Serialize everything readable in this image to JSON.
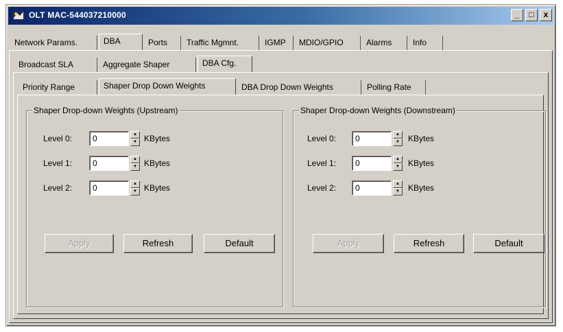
{
  "window": {
    "title": "OLT MAC-544037210000"
  },
  "caption_buttons": {
    "minimize": "_",
    "maximize": "□",
    "close": "x"
  },
  "tabs_main": [
    "Network Params.",
    "DBA",
    "Ports",
    "Traffic Mgmnt.",
    "IGMP",
    "MDIO/GPIO",
    "Alarms",
    "Info"
  ],
  "tabs_main_active": "DBA",
  "tabs_dba": [
    "Broadcast SLA",
    "Aggregate Shaper",
    "DBA Cfg."
  ],
  "tabs_dba_active": "DBA Cfg.",
  "tabs_cfg": [
    "Priority Range",
    "Shaper Drop Down Weights",
    "DBA Drop Down Weights",
    "Polling Rate"
  ],
  "tabs_cfg_active": "Shaper Drop Down Weights",
  "upstream": {
    "title": "Shaper Drop-down Weights (Upstream)",
    "levels": [
      {
        "label": "Level 0:",
        "value": "0",
        "unit": "KBytes"
      },
      {
        "label": "Level 1:",
        "value": "0",
        "unit": "KBytes"
      },
      {
        "label": "Level 2:",
        "value": "0",
        "unit": "KBytes"
      }
    ],
    "buttons": {
      "apply": "Apply",
      "refresh": "Refresh",
      "default": "Default"
    }
  },
  "downstream": {
    "title": "Shaper Drop-down Weights (Downstream)",
    "levels": [
      {
        "label": "Level 0:",
        "value": "0",
        "unit": "KBytes"
      },
      {
        "label": "Level 1:",
        "value": "0",
        "unit": "KBytes"
      },
      {
        "label": "Level 2:",
        "value": "0",
        "unit": "KBytes"
      }
    ],
    "buttons": {
      "apply": "Apply",
      "refresh": "Refresh",
      "default": "Default"
    }
  },
  "colors": {
    "face": "#d4d0c8",
    "title_start": "#0a246a",
    "title_end": "#a6caf0"
  },
  "icons": {
    "app": "application-icon",
    "spin_up": "arrow-up-icon",
    "spin_down": "arrow-down-icon"
  }
}
